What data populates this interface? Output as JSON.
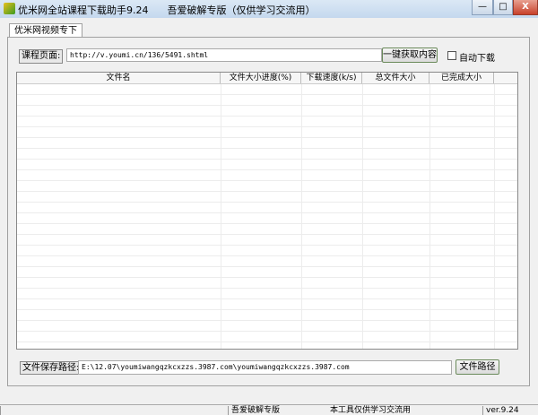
{
  "window": {
    "title": "优米网全站课程下载助手9.24      吾爱破解专版（仅供学习交流用）",
    "minimize": "—",
    "maximize": "□",
    "close": "X"
  },
  "tab": {
    "label": "优米网视频专下"
  },
  "course": {
    "label": "课程页面:",
    "url": "http://v.youmi.cn/136/5491.shtml",
    "fetch_button": "一键获取内容",
    "auto_download": "自动下载",
    "auto_download_checked": false
  },
  "table": {
    "columns": [
      "文件名",
      "文件大小",
      "进度(%)",
      "下载速度(k/s)",
      "总文件大小",
      "已完成大小"
    ],
    "rows": []
  },
  "save": {
    "label": "文件保存路径:",
    "path": "E:\\12.07\\youmiwangqzkcxzzs.3987.com\\youmiwangqzkcxzzs.3987.com",
    "button": "文件路径"
  },
  "statusbar": {
    "edition": "吾爱破解专版",
    "notice": "本工具仅供学习交流用",
    "version": "ver.9.24"
  }
}
